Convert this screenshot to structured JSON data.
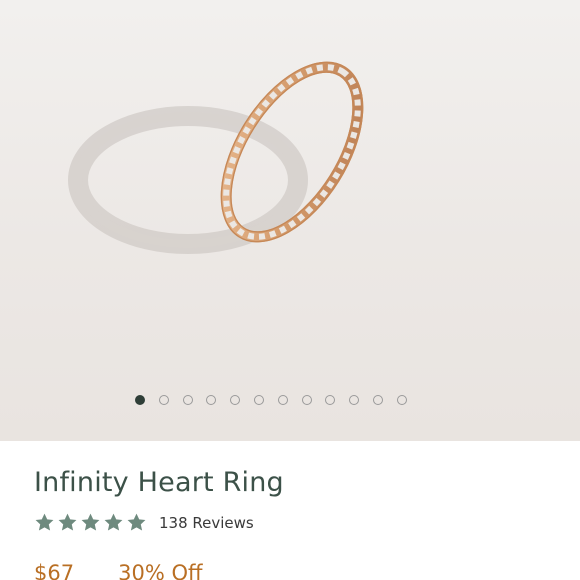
{
  "gallery": {
    "slide_count": 12,
    "active_index": 0
  },
  "product": {
    "title": "Infinity Heart Ring",
    "rating": {
      "stars": 5,
      "reviews_label": "138 Reviews"
    },
    "price": "$67",
    "discount": "30% Off"
  },
  "colors": {
    "title": "#3c5148",
    "star": "#6e8a7e",
    "price": "#b96f24",
    "dot_active": "#2f3e37",
    "ring_gold": "#d6a077"
  }
}
